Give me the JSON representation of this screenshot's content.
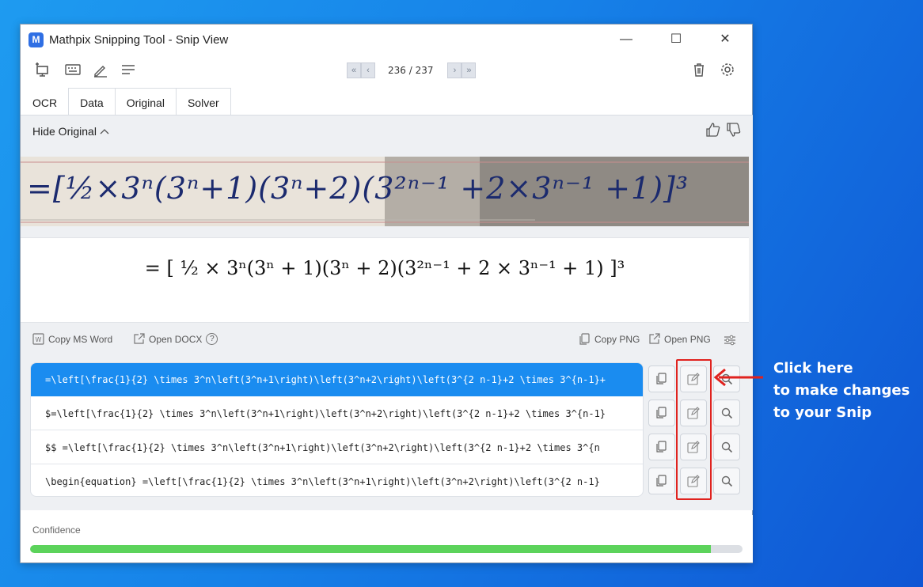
{
  "window": {
    "title": "Mathpix Snipping Tool - Snip View",
    "logo_letter": "M",
    "minimize": "—",
    "maximize": "☐",
    "close": "✕"
  },
  "pager": {
    "first": "«",
    "prev": "‹",
    "next": "›",
    "last": "»",
    "count": "236 / 237"
  },
  "tabs": [
    "OCR",
    "Data",
    "Original",
    "Solver"
  ],
  "original": {
    "toggle_label": "Hide Original",
    "photo_text": "=[½×3ⁿ(3ⁿ+1)(3ⁿ+2)(3²ⁿ⁻¹ +2×3ⁿ⁻¹ +1)]³"
  },
  "rendered_math": {
    "expression": "= [ ½ × 3ⁿ(3ⁿ + 1)(3ⁿ + 2)(3²ⁿ⁻¹ + 2 × 3ⁿ⁻¹ + 1) ]³"
  },
  "actions": {
    "copy_ms_word": "Copy MS Word",
    "open_docx": "Open DOCX",
    "help": "?",
    "copy_png": "Copy PNG",
    "open_png": "Open PNG"
  },
  "results": [
    "=\\left[\\frac{1}{2} \\times 3^n\\left(3^n+1\\right)\\left(3^n+2\\right)\\left(3^{2 n-1}+2 \\times 3^{n-1}+",
    "$=\\left[\\frac{1}{2} \\times 3^n\\left(3^n+1\\right)\\left(3^n+2\\right)\\left(3^{2 n-1}+2 \\times 3^{n-1}",
    "$$  =\\left[\\frac{1}{2} \\times 3^n\\left(3^n+1\\right)\\left(3^n+2\\right)\\left(3^{2 n-1}+2 \\times 3^{n",
    "\\begin{equation}  =\\left[\\frac{1}{2} \\times 3^n\\left(3^n+1\\right)\\left(3^n+2\\right)\\left(3^{2 n-1}"
  ],
  "confidence": {
    "label": "Confidence",
    "value": 0.955,
    "color": "#5cd35b"
  },
  "callout": {
    "line1": "Click here",
    "line2": "to make changes",
    "line3": "to your Snip"
  },
  "colors": {
    "selected_row": "#1a8cf0",
    "highlight": "#e0221e",
    "logo": "#2f6fe4"
  }
}
